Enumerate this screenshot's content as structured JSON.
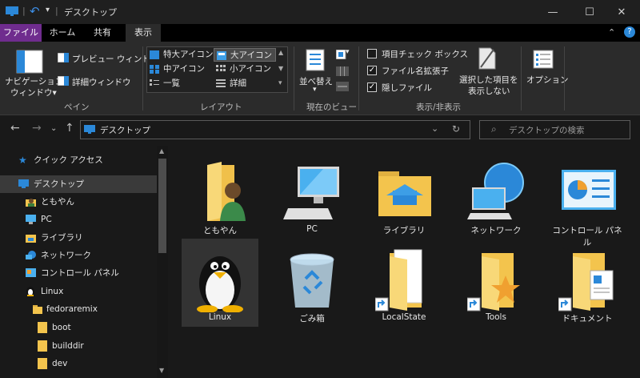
{
  "window": {
    "title": "デスクトップ",
    "controls": {
      "minimize": "—",
      "maximize": "☐",
      "close": "✕"
    }
  },
  "ribbon_tabs": [
    "ファイル",
    "ホーム",
    "共有",
    "表示"
  ],
  "ribbon": {
    "pane": {
      "navigation": "ナビゲーション",
      "navigation2": "ウィンドウ▾",
      "preview": "プレビュー ウィンドウ",
      "details": "詳細ウィンドウ",
      "group": "ペイン"
    },
    "layout": {
      "items": [
        "特大アイコン",
        "大アイコン",
        "中アイコン",
        "小アイコン",
        "一覧",
        "詳細"
      ],
      "group": "レイアウト"
    },
    "current_view": {
      "sort": "並べ替え",
      "sort_arrow": "▾",
      "group": "現在のビュー"
    },
    "show_hide": {
      "item_checkbox": "項目チェック ボックス",
      "file_ext": "ファイル名拡張子",
      "hidden": "隠しファイル",
      "hide_selected": "選択した項目を",
      "hide_selected2": "表示しない",
      "group": "表示/非表示"
    },
    "options": "オプション",
    "checkbox_states": {
      "item_checkbox": false,
      "file_ext": true,
      "hidden": true
    }
  },
  "address": {
    "path": "デスクトップ",
    "search_placeholder": "デスクトップの検索"
  },
  "sidebar": {
    "items": [
      "クイック アクセス",
      "デスクトップ",
      "ともやん",
      "PC",
      "ライブラリ",
      "ネットワーク",
      "コントロール パネル",
      "Linux",
      "fedoraremix",
      "boot",
      "builddir",
      "dev"
    ]
  },
  "content": {
    "items": [
      "ともやん",
      "PC",
      "ライブラリ",
      "ネットワーク",
      "コントロール パネル",
      "Linux",
      "ごみ箱",
      "LocalState",
      "Tools",
      "ドキュメント"
    ]
  },
  "colors": {
    "accent_file_tab": "#6f2c8e",
    "selection": "#3a3a3a",
    "folder": "#f3c44d"
  }
}
